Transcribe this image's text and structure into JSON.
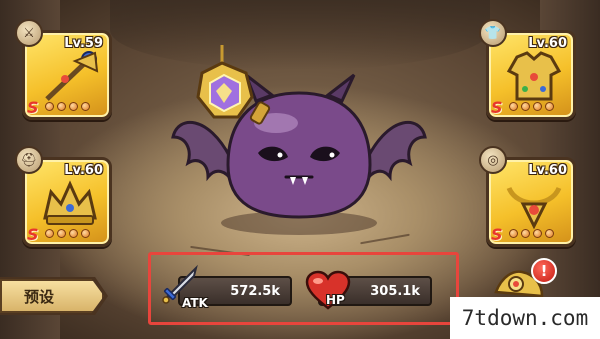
{
  "equipment": {
    "weapon": {
      "level": "Lv.59",
      "grade": "S",
      "icon": "sword-icon",
      "stars": 4
    },
    "armor": {
      "level": "Lv.60",
      "grade": "S",
      "icon": "shirt-icon",
      "stars": 4
    },
    "helmet": {
      "level": "Lv.60",
      "grade": "S",
      "icon": "helmet-icon",
      "stars": 4
    },
    "necklace": {
      "level": "Lv.60",
      "grade": "S",
      "icon": "necklace-icon",
      "stars": 4
    }
  },
  "stats": {
    "atk_label": "ATK",
    "atk_value": "572.5k",
    "hp_label": "HP",
    "hp_value": "305.1k"
  },
  "preset_button": "预设",
  "alert_badge": "!",
  "watermark": "7tdown.com",
  "colors": {
    "slot_gold": "#f5c02a",
    "highlight_red": "#e8453c",
    "grade_red": "#e8372c",
    "pet_purple": "#7a4a8a"
  }
}
